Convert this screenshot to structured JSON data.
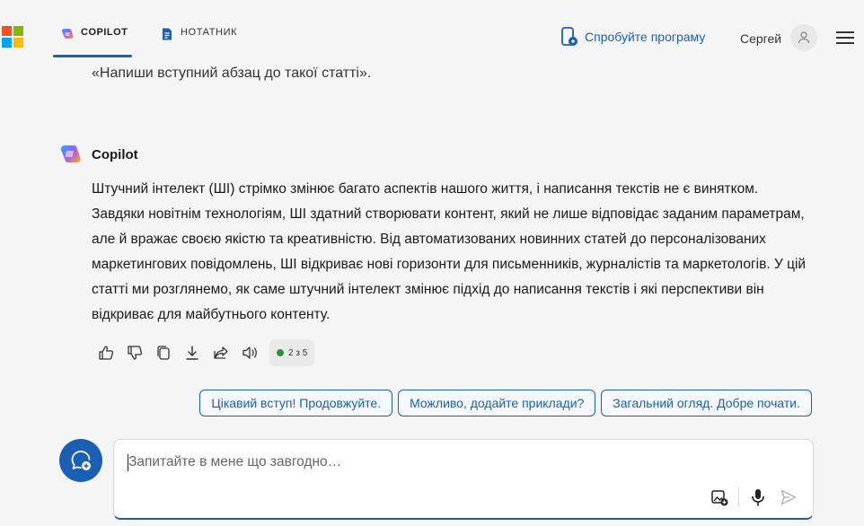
{
  "header": {
    "tabs": [
      {
        "label": "COPILOT",
        "active": true
      },
      {
        "label": "НОТАТНИК",
        "active": false
      }
    ],
    "try_app_label": "Спробуйте програму",
    "user_name": "Сергей",
    "brand_color": "#1a5fb4"
  },
  "conversation": {
    "previous_user_message": "«Напиши вступний абзац до такої статті».",
    "bot": {
      "name": "Copilot",
      "message": "Штучний інтелект (ШІ) стрімко змінює багато аспектів нашого життя, і написання текстів не є винятком. Завдяки новітнім технологіям, ШІ здатний створювати контент, який не лише відповідає заданим параметрам, але й вражає своєю якістю та креативністю. Від автоматизованих новинних статей до персоналізованих маркетингових повідомлень, ШІ відкриває нові горизонти для письменників, журналістів та маркетологів. У цій статті ми розглянемо, як саме штучний інтелект змінює підхід до написання текстів і які перспективи він відкриває для майбутнього контенту.",
      "actions": [
        "thumbs-up-icon",
        "thumbs-down-icon",
        "copy-icon",
        "download-icon",
        "share-icon",
        "speaker-icon"
      ],
      "page_indicator": "2 з 5"
    },
    "suggestions": [
      "Цікавий вступ! Продовжуйте.",
      "Можливо, додайте приклади?",
      "Загальний огляд. Добре почати."
    ]
  },
  "composer": {
    "placeholder": "Запитайте в мене що завгодно…",
    "value": ""
  }
}
